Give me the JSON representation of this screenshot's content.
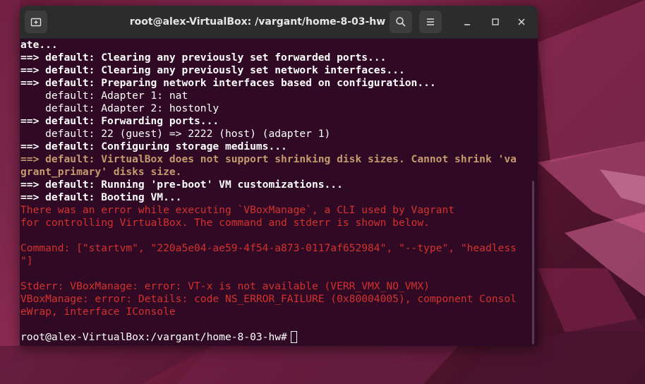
{
  "window": {
    "title": "root@alex-VirtualBox: /vargant/home-8-03-hw",
    "new_tab_icon": "new-tab-icon",
    "search_icon": "search-icon",
    "menu_icon": "hamburger-menu-icon"
  },
  "colors": {
    "terminal_bg": "#300a24",
    "titlebar_bg": "#2c2c2c",
    "text": "#ffffff",
    "warning": "#c59a6f",
    "error": "#d3312f"
  },
  "terminal": {
    "lines": [
      {
        "text": "ate...",
        "style": "b"
      },
      {
        "text": "==> default: Clearing any previously set forwarded ports...",
        "style": "b"
      },
      {
        "text": "==> default: Clearing any previously set network interfaces...",
        "style": "b"
      },
      {
        "text": "==> default: Preparing network interfaces based on configuration...",
        "style": "b"
      },
      {
        "text": "    default: Adapter 1: nat",
        "style": ""
      },
      {
        "text": "    default: Adapter 2: hostonly",
        "style": ""
      },
      {
        "text": "==> default: Forwarding ports...",
        "style": "b"
      },
      {
        "text": "    default: 22 (guest) => 2222 (host) (adapter 1)",
        "style": ""
      },
      {
        "text": "==> default: Configuring storage mediums...",
        "style": "b"
      },
      {
        "text": "==> default: VirtualBox does not support shrinking disk sizes. Cannot shrink 'va",
        "style": "warn"
      },
      {
        "text": "grant_primary' disks size.",
        "style": "warn"
      },
      {
        "text": "==> default: Running 'pre-boot' VM customizations...",
        "style": "b"
      },
      {
        "text": "==> default: Booting VM...",
        "style": "b"
      },
      {
        "text": "There was an error while executing `VBoxManage`, a CLI used by Vagrant",
        "style": "err"
      },
      {
        "text": "for controlling VirtualBox. The command and stderr is shown below.",
        "style": "err"
      },
      {
        "text": "",
        "style": ""
      },
      {
        "text": "Command: [\"startvm\", \"220a5e04-ae59-4f54-a873-0117af652984\", \"--type\", \"headless",
        "style": "err"
      },
      {
        "text": "\"]",
        "style": "err"
      },
      {
        "text": "",
        "style": ""
      },
      {
        "text": "Stderr: VBoxManage: error: VT-x is not available (VERR_VMX_NO_VMX)",
        "style": "err"
      },
      {
        "text": "VBoxManage: error: Details: code NS_ERROR_FAILURE (0x80004005), component Consol",
        "style": "err"
      },
      {
        "text": "eWrap, interface IConsole",
        "style": "err"
      },
      {
        "text": "",
        "style": ""
      }
    ],
    "prompt": "root@alex-VirtualBox:/vargant/home-8-03-hw#"
  }
}
